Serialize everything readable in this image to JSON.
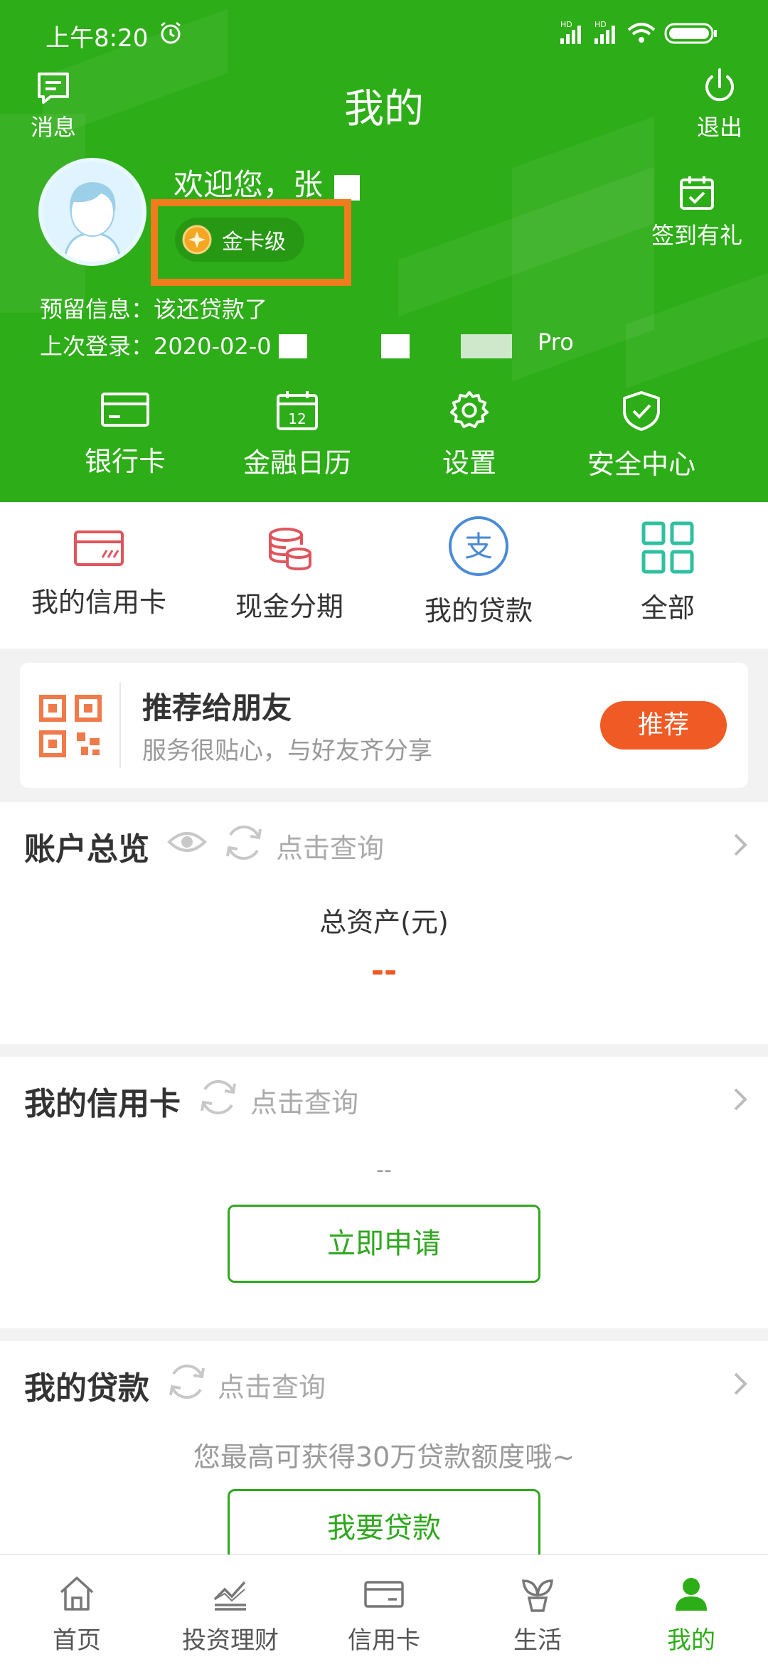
{
  "status_bar": {
    "time": "上午8:20",
    "signal1": "HD",
    "signal2": "HD"
  },
  "header": {
    "title": "我的",
    "messages_label": "消息",
    "logout_label": "退出",
    "checkin_label": "签到有礼",
    "welcome": "欢迎您，张",
    "level": "金卡级",
    "reserved_info": "预留信息：该还贷款了",
    "last_login": "上次登录：2020-02-0",
    "last_login_tail": "Pro"
  },
  "quick_actions": [
    {
      "label": "银行卡",
      "icon": "bank-card-icon"
    },
    {
      "label": "金融日历",
      "icon": "calendar-icon"
    },
    {
      "label": "设置",
      "icon": "gear-icon"
    },
    {
      "label": "安全中心",
      "icon": "shield-check-icon"
    }
  ],
  "calendar_day": "12",
  "services": [
    {
      "label": "我的信用卡",
      "icon": "credit-card-icon"
    },
    {
      "label": "现金分期",
      "icon": "coins-icon"
    },
    {
      "label": "我的贷款",
      "icon": "alipay-icon",
      "glyph": "支"
    },
    {
      "label": "全部",
      "icon": "grid-icon"
    }
  ],
  "promo": {
    "title": "推荐给朋友",
    "subtitle": "服务很贴心，与好友齐分享",
    "button": "推荐"
  },
  "account_overview": {
    "title": "账户总览",
    "query": "点击查询",
    "total_label": "总资产(元)",
    "total_value": "--"
  },
  "credit_card": {
    "title": "我的信用卡",
    "query": "点击查询",
    "value": "--",
    "button": "立即申请"
  },
  "loan": {
    "title": "我的贷款",
    "query": "点击查询",
    "message": "您最高可获得30万贷款额度哦~",
    "button": "我要贷款"
  },
  "tabs": [
    {
      "label": "首页",
      "icon": "home-icon"
    },
    {
      "label": "投资理财",
      "icon": "investment-chart-icon"
    },
    {
      "label": "信用卡",
      "icon": "card-icon"
    },
    {
      "label": "生活",
      "icon": "sprout-icon"
    },
    {
      "label": "我的",
      "icon": "person-icon",
      "active": true
    }
  ],
  "colors": {
    "primary": "#2dad17",
    "accent": "#f05a24",
    "highlight": "#f07c1e",
    "link_green": "#2ea81e"
  }
}
